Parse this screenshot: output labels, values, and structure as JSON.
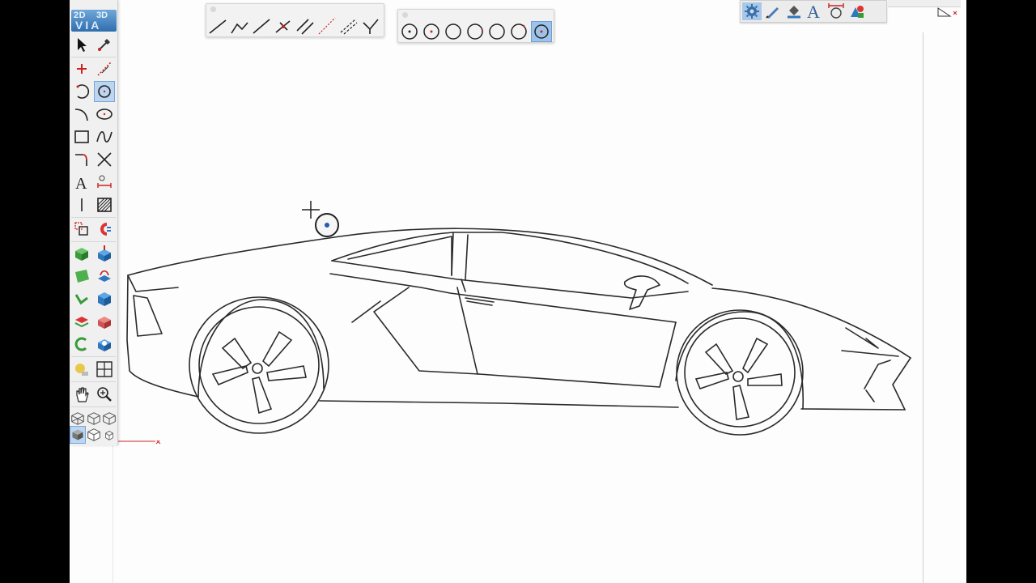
{
  "app": {
    "logo_line1": "2D",
    "logo_line2": "3D",
    "logo_line3": "VIA"
  },
  "left_palette": {
    "tools": [
      {
        "name": "select-arrow-icon",
        "selected": false
      },
      {
        "name": "eyedropper-icon",
        "selected": false
      },
      {
        "name": "point-icon",
        "selected": false
      },
      {
        "name": "construction-line-icon",
        "selected": false
      },
      {
        "name": "arc-icon",
        "selected": false
      },
      {
        "name": "circle-icon",
        "selected": true
      },
      {
        "name": "curve-arc-icon",
        "selected": false
      },
      {
        "name": "ellipse-icon",
        "selected": false
      },
      {
        "name": "rectangle-icon",
        "selected": false
      },
      {
        "name": "spline-icon",
        "selected": false
      },
      {
        "name": "fillet-icon",
        "selected": false
      },
      {
        "name": "trim-icon",
        "selected": false
      },
      {
        "name": "text-icon",
        "selected": false
      },
      {
        "name": "dimension-icon",
        "selected": false
      },
      {
        "name": "text-cursor-icon",
        "selected": false
      },
      {
        "name": "hatch-icon",
        "selected": false
      },
      {
        "name": "transform-icon",
        "selected": false
      },
      {
        "name": "magnet-icon",
        "selected": false
      },
      {
        "name": "extrude-icon",
        "selected": false
      },
      {
        "name": "push-pull-icon",
        "selected": false
      },
      {
        "name": "surface-icon",
        "selected": false
      },
      {
        "name": "sweep-icon",
        "selected": false
      },
      {
        "name": "loft-icon",
        "selected": false
      },
      {
        "name": "box-blue-icon",
        "selected": false
      },
      {
        "name": "split-icon",
        "selected": false
      },
      {
        "name": "union-icon",
        "selected": false
      },
      {
        "name": "revolve-icon",
        "selected": false
      },
      {
        "name": "boolean-icon",
        "selected": false
      },
      {
        "name": "material-icon",
        "selected": false
      },
      {
        "name": "views-icon",
        "selected": false
      },
      {
        "name": "pan-hand-icon",
        "selected": false
      },
      {
        "name": "zoom-icon",
        "selected": false
      },
      {
        "name": "wireframe-iso-icon",
        "selected": false
      },
      {
        "name": "wireframe-front-icon",
        "selected": false
      },
      {
        "name": "wireframe-side-icon",
        "selected": false
      },
      {
        "name": "shaded-iso-icon",
        "selected": false
      },
      {
        "name": "hidden-line-icon",
        "selected": false
      },
      {
        "name": "small-view-icon",
        "selected": false
      }
    ]
  },
  "line_palette": {
    "tools": [
      "line-icon",
      "polyline-icon",
      "line-angle-icon",
      "perpendicular-line-icon",
      "parallel-line-icon",
      "dashed-line-icon",
      "offset-line-icon",
      "bisector-line-icon"
    ]
  },
  "circle_palette": {
    "tools": [
      "circle-center-radius-icon",
      "circle-center-point-icon",
      "circle-2-point-icon",
      "circle-3-point-icon",
      "circle-tangent-icon",
      "circle-tangent-3-icon",
      "circle-selected-icon"
    ],
    "selected_index": 6
  },
  "top_right_bar": {
    "tools": [
      "settings-gear-icon",
      "pencil-icon",
      "paint-bucket-icon",
      "text-style-icon",
      "dimension-style-icon",
      "shapes-icon"
    ],
    "selected_index": 0
  },
  "colors": {
    "accent_selected": "#9ec3ea",
    "canvas_bg": "#fdfdfd",
    "palette_bg": "#f0f0f0",
    "origin_axis": "#cc2222"
  }
}
